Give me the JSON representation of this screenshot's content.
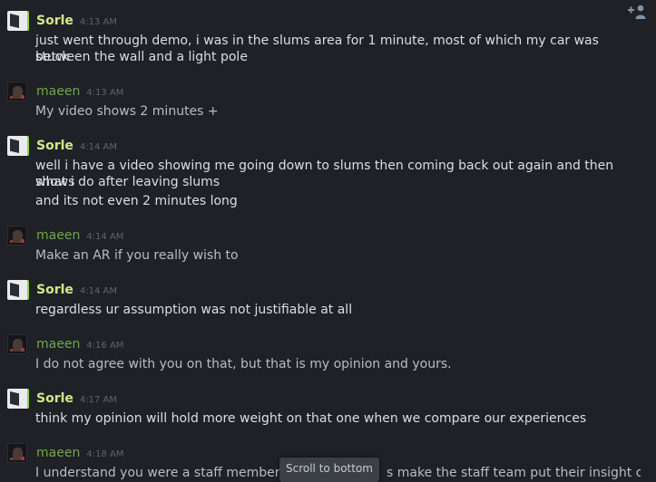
{
  "toolbar": {
    "add_user_icon": "add-user-icon"
  },
  "messages": [
    {
      "author": "Sorle",
      "time": "4:13 AM",
      "lines": [
        "just went through demo, i was in the slums area for 1 minute, most of which my car was stuck",
        "between the wall and a light pole"
      ]
    },
    {
      "author": "maeen",
      "time": "4:13 AM",
      "lines": [
        "My video shows 2 minutes +"
      ]
    },
    {
      "author": "Sorle",
      "time": "4:14 AM",
      "lines": [
        "well i have a video showing me going down to slums then coming back out again and then shows",
        "what i do after leaving slums",
        "and its not even 2 minutes long"
      ]
    },
    {
      "author": "maeen",
      "time": "4:14 AM",
      "lines": [
        "Make an AR if you really wish to"
      ]
    },
    {
      "author": "Sorle",
      "time": "4:14 AM",
      "lines": [
        "regardless ur assumption was not justifiable at all"
      ]
    },
    {
      "author": "maeen",
      "time": "4:16 AM",
      "lines": [
        "I do not agree with you on that, but that is my opinion and yours."
      ]
    },
    {
      "author": "Sorle",
      "time": "4:17 AM",
      "lines": [
        "think my opinion will hold more weight on that one when we compare our experiences"
      ]
    },
    {
      "author": "maeen",
      "time": "4:18 AM",
      "lines": [
        "I understand you were a staff member, yo",
        "s make the staff team put their insight on"
      ]
    }
  ],
  "scroll_to_bottom": "Scroll to bottom"
}
